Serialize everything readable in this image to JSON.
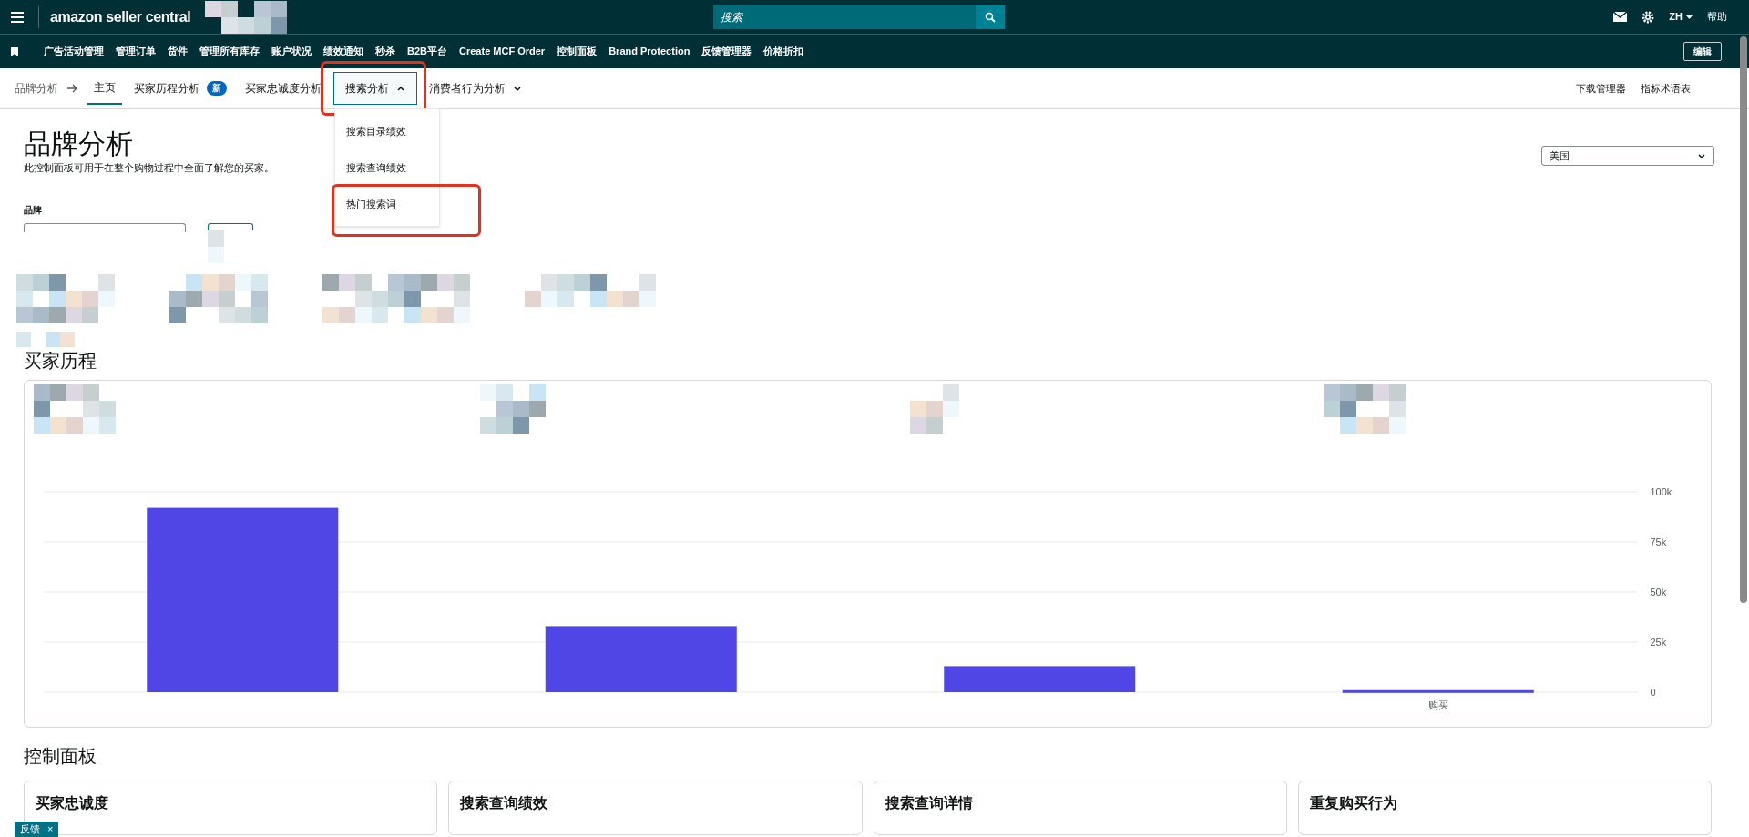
{
  "top_bar": {
    "logo": "amazon seller central",
    "search": {
      "placeholder": "搜索"
    },
    "language": "ZH",
    "help": "帮助"
  },
  "nav": {
    "items": [
      "广告活动管理",
      "管理订单",
      "货件",
      "管理所有库存",
      "账户状况",
      "绩效通知",
      "秒杀",
      "B2B平台",
      "Create MCF Order",
      "控制面板",
      "Brand Protection",
      "反馈管理器",
      "价格折扣"
    ],
    "edit_button": "编辑"
  },
  "sub_nav": {
    "breadcrumb": "品牌分析",
    "tabs": [
      {
        "label": "主页",
        "selected": true,
        "dropdown": false,
        "highlighted": false
      },
      {
        "label": "买家历程分析",
        "badge": "新",
        "selected": false,
        "dropdown": false,
        "highlighted": false
      },
      {
        "label": "买家忠诚度分析",
        "selected": false,
        "dropdown": false,
        "highlighted": false
      },
      {
        "label": "搜索分析",
        "selected": false,
        "dropdown": true,
        "expanded": true,
        "highlighted": true
      },
      {
        "label": "消费者行为分析",
        "selected": false,
        "dropdown": true,
        "expanded": false,
        "highlighted": false
      }
    ],
    "links": [
      "下载管理器",
      "指标术语表"
    ],
    "menu": [
      {
        "label": "搜索目录绩效",
        "highlighted": false
      },
      {
        "label": "搜索查询绩效",
        "highlighted": false
      },
      {
        "label": "热门搜索词",
        "highlighted": true
      }
    ]
  },
  "page": {
    "title": "品牌分析",
    "description": "此控制面板可用于在整个购物过程中全面了解您的买家。",
    "brand_label": "品牌",
    "marketplace": "美国"
  },
  "journey": {
    "title": "买家历程",
    "chart_data": {
      "type": "bar",
      "grid": true,
      "categories": [
        null,
        null,
        null,
        "购买"
      ],
      "values": [
        92000,
        33000,
        13000,
        1000
      ],
      "ylim": [
        0,
        100000
      ],
      "yticks": [
        {
          "value": 0,
          "label": "0"
        },
        {
          "value": 25000,
          "label": "25k"
        },
        {
          "value": 50000,
          "label": "50k"
        },
        {
          "value": 75000,
          "label": "75k"
        },
        {
          "value": 100000,
          "label": "100k"
        }
      ]
    }
  },
  "dashboard": {
    "title": "控制面板",
    "cards": [
      "买家忠诚度",
      "搜索查询绩效",
      "搜索查询详情",
      "重复购买行为"
    ]
  },
  "feedback": {
    "label": "反馈",
    "close": "×"
  }
}
